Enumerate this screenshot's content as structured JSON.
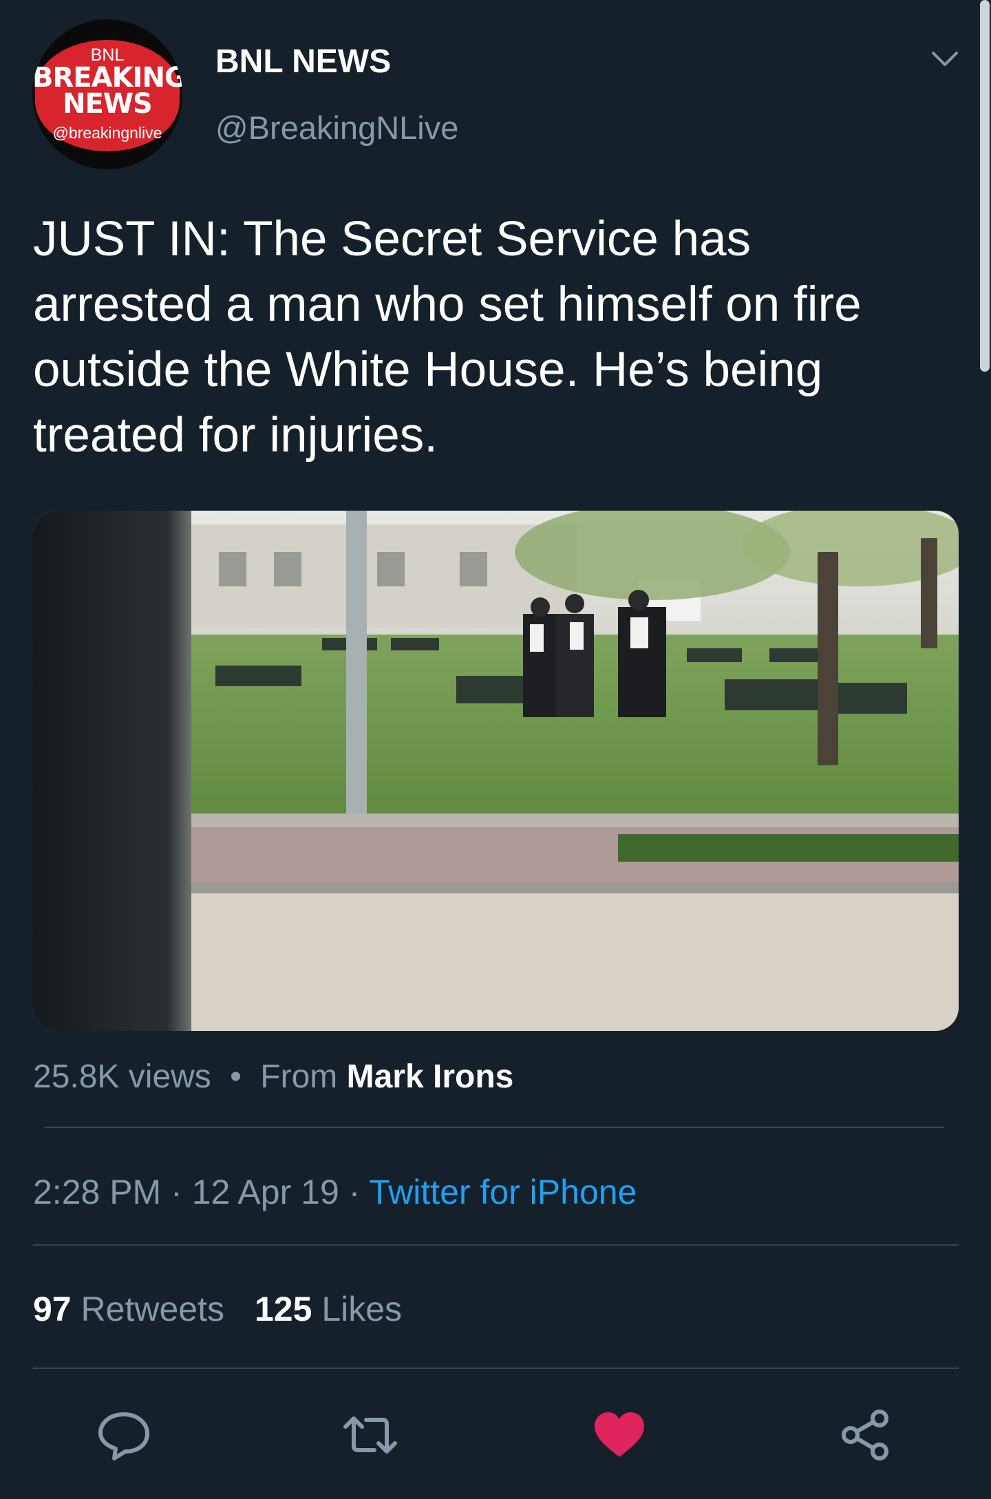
{
  "author": {
    "name": "BNL NEWS",
    "handle": "@BreakingNLive",
    "avatar": {
      "top_text": "BNL",
      "line1": "BREAKING",
      "line2": "NEWS",
      "handle_text": "@breakingnlive",
      "badge_color": "#d8242c"
    }
  },
  "tweet": {
    "text_lines": [
      "JUST IN: The Secret Service has",
      "arrested a man who set himself on fire",
      "outside the White House. He’s being",
      "treated for injuries."
    ]
  },
  "media": {
    "views": "25.8K views",
    "separator": "•",
    "from_label": "From",
    "from_author": "Mark Irons"
  },
  "meta": {
    "time": "2:28 PM",
    "sep1": "·",
    "date": "12 Apr 19",
    "sep2": "·",
    "source": "Twitter for iPhone"
  },
  "stats": {
    "retweets_count": "97",
    "retweets_label": "Retweets",
    "likes_count": "125",
    "likes_label": "Likes"
  },
  "actions": [
    "reply-icon",
    "retweet-icon",
    "like-icon",
    "share-icon"
  ],
  "colors": {
    "background": "#15202b",
    "muted": "#8899a6",
    "link": "#1da1f2",
    "like": "#e0245e",
    "divider": "#38444d"
  }
}
